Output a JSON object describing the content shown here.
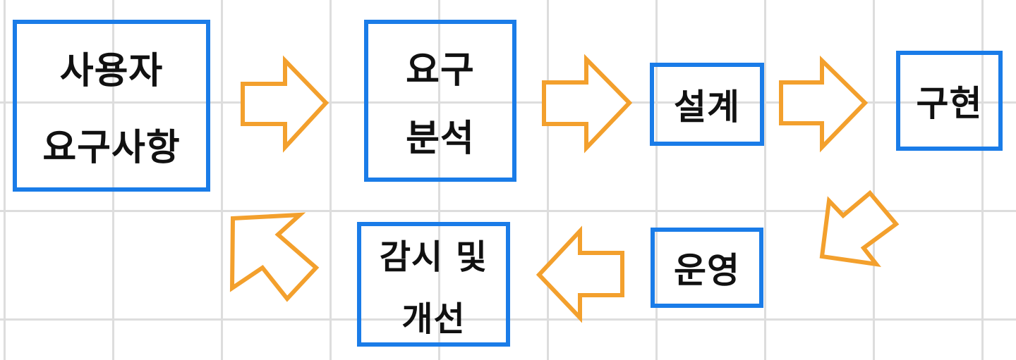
{
  "colors": {
    "box_border": "#1a7ce8",
    "arrow": "#f3a02d",
    "grid": "#dddddd",
    "text": "#111111"
  },
  "nodes": {
    "requirements": {
      "line1": "사용자",
      "line2": "요구사항"
    },
    "analysis": {
      "line1": "요구",
      "line2": "분석"
    },
    "design": {
      "label": "설계"
    },
    "implementation": {
      "label": "구현"
    },
    "operation": {
      "label": "운영"
    },
    "monitoring": {
      "line1": "감시 및",
      "line2": "개선"
    }
  },
  "flow": [
    [
      "requirements",
      "analysis"
    ],
    [
      "analysis",
      "design"
    ],
    [
      "design",
      "implementation"
    ],
    [
      "implementation",
      "operation"
    ],
    [
      "operation",
      "monitoring"
    ],
    [
      "monitoring",
      "requirements"
    ]
  ]
}
